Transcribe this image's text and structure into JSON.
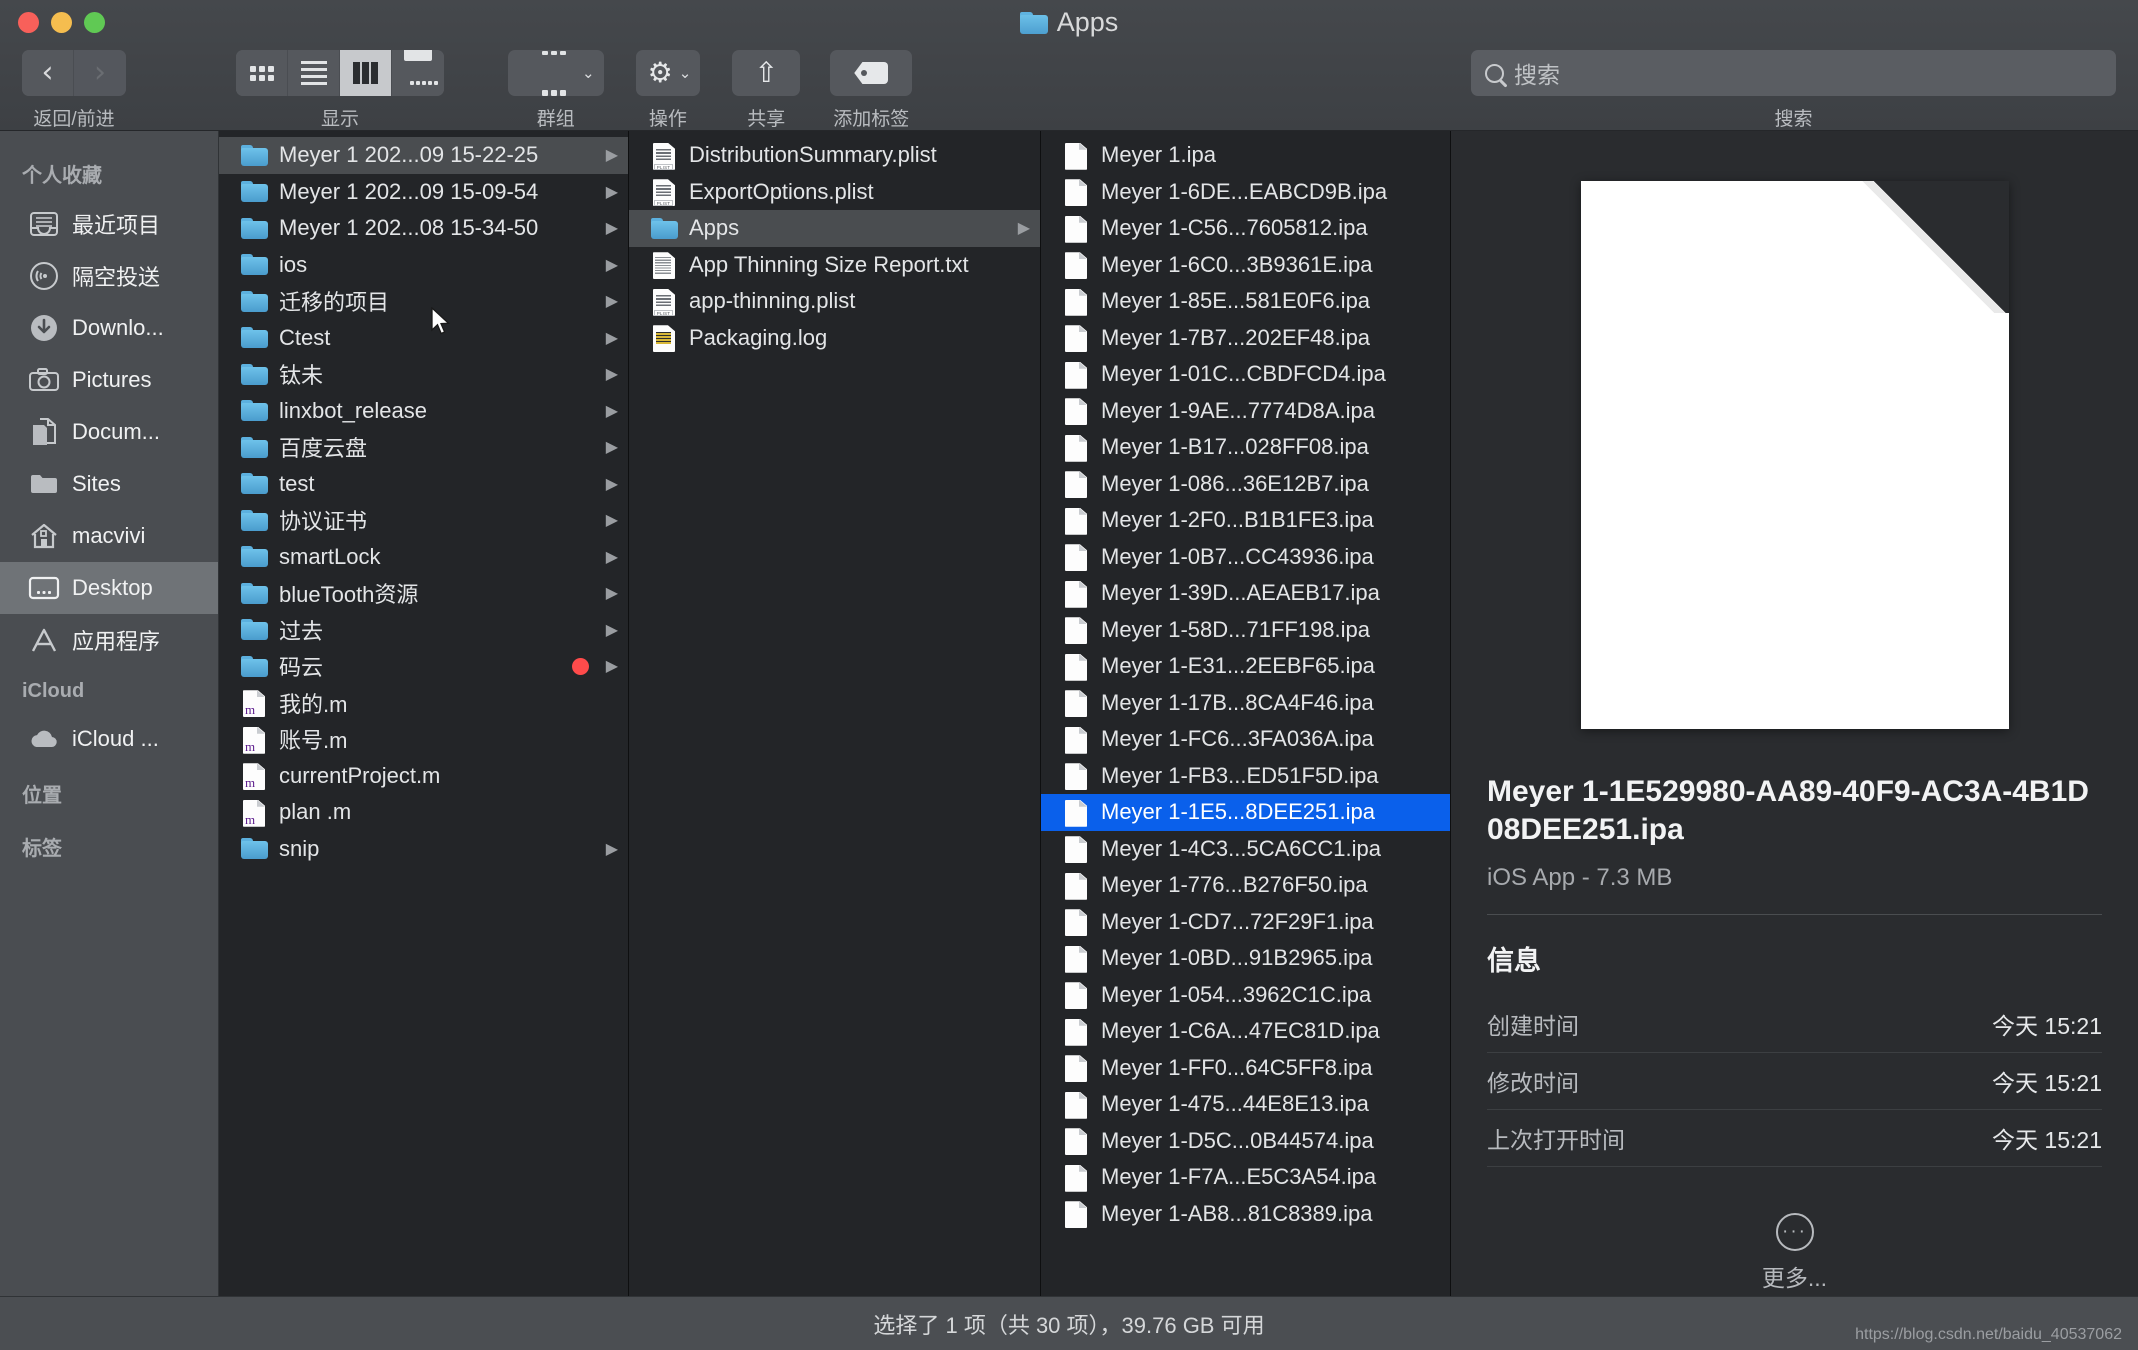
{
  "window": {
    "title": "Apps",
    "traffic_lights": [
      "close-red",
      "minimize-yellow",
      "zoom-green"
    ]
  },
  "toolbar": {
    "nav_label": "返回/前进",
    "back_glyph": "‹",
    "forward_glyph": "›",
    "view_label": "显示",
    "group_label": "群组",
    "action_label": "操作",
    "share_label": "共享",
    "tag_label": "添加标签",
    "search_label": "搜索",
    "gear_glyph": "⚙",
    "share_glyph": "⇧",
    "caret_glyph": "⌄"
  },
  "search": {
    "placeholder": "搜索",
    "value": ""
  },
  "sidebar": {
    "sections": [
      {
        "header": "个人收藏",
        "items": [
          {
            "label": "最近项目",
            "icon": "recents-icon",
            "selected": false
          },
          {
            "label": "隔空投送",
            "icon": "airdrop-icon",
            "selected": false
          },
          {
            "label": "Downlo...",
            "icon": "downloads-icon",
            "selected": false
          },
          {
            "label": "Pictures",
            "icon": "pictures-icon",
            "selected": false
          },
          {
            "label": "Docum...",
            "icon": "documents-icon",
            "selected": false
          },
          {
            "label": "Sites",
            "icon": "folder-icon",
            "selected": false
          },
          {
            "label": "macvivi",
            "icon": "home-icon",
            "selected": false
          },
          {
            "label": "Desktop",
            "icon": "desktop-icon",
            "selected": true
          },
          {
            "label": "应用程序",
            "icon": "applications-icon",
            "selected": false
          }
        ]
      },
      {
        "header": "iCloud",
        "items": [
          {
            "label": "iCloud ...",
            "icon": "cloud-icon",
            "selected": false
          }
        ]
      },
      {
        "header": "位置",
        "items": []
      },
      {
        "header": "标签",
        "items": []
      }
    ]
  },
  "columns": [
    {
      "name": "column-1",
      "rows": [
        {
          "label": "Meyer 1 202...09 15-22-25",
          "icon": "folder-icon",
          "arrow": true,
          "state": "highlight"
        },
        {
          "label": "Meyer 1 202...09 15-09-54",
          "icon": "folder-icon",
          "arrow": true,
          "state": "normal"
        },
        {
          "label": "Meyer 1 202...08 15-34-50",
          "icon": "folder-icon",
          "arrow": true,
          "state": "normal"
        },
        {
          "label": "ios",
          "icon": "folder-icon",
          "arrow": true,
          "state": "normal"
        },
        {
          "label": "迁移的项目",
          "icon": "folder-icon",
          "arrow": true,
          "state": "normal"
        },
        {
          "label": "Ctest",
          "icon": "folder-icon",
          "arrow": true,
          "state": "normal"
        },
        {
          "label": "钛未",
          "icon": "folder-icon",
          "arrow": true,
          "state": "normal"
        },
        {
          "label": "linxbot_release",
          "icon": "folder-icon",
          "arrow": true,
          "state": "normal"
        },
        {
          "label": "百度云盘",
          "icon": "folder-icon",
          "arrow": true,
          "state": "normal"
        },
        {
          "label": "test",
          "icon": "folder-icon",
          "arrow": true,
          "state": "normal"
        },
        {
          "label": "协议证书",
          "icon": "folder-icon",
          "arrow": true,
          "state": "normal"
        },
        {
          "label": "smartLock",
          "icon": "folder-icon",
          "arrow": true,
          "state": "normal"
        },
        {
          "label": "blueTooth资源",
          "icon": "folder-icon",
          "arrow": true,
          "state": "normal"
        },
        {
          "label": "过去",
          "icon": "folder-icon",
          "arrow": true,
          "state": "normal"
        },
        {
          "label": "码云",
          "icon": "folder-icon",
          "arrow": true,
          "state": "normal",
          "tag": "red"
        },
        {
          "label": "我的.m",
          "icon": "m-file-icon",
          "arrow": false,
          "state": "normal"
        },
        {
          "label": "账号.m",
          "icon": "m-file-icon",
          "arrow": false,
          "state": "normal"
        },
        {
          "label": "currentProject.m",
          "icon": "m-file-icon",
          "arrow": false,
          "state": "normal"
        },
        {
          "label": "plan .m",
          "icon": "m-file-icon",
          "arrow": false,
          "state": "normal"
        },
        {
          "label": "snip",
          "icon": "folder-icon",
          "arrow": true,
          "state": "normal"
        }
      ]
    },
    {
      "name": "column-2",
      "rows": [
        {
          "label": "DistributionSummary.plist",
          "icon": "plist-icon",
          "arrow": false,
          "state": "normal"
        },
        {
          "label": "ExportOptions.plist",
          "icon": "plist-icon",
          "arrow": false,
          "state": "normal"
        },
        {
          "label": "Apps",
          "icon": "folder-icon",
          "arrow": true,
          "state": "highlight"
        },
        {
          "label": "App Thinning Size Report.txt",
          "icon": "text-doc-icon",
          "arrow": false,
          "state": "normal"
        },
        {
          "label": "app-thinning.plist",
          "icon": "plist-icon",
          "arrow": false,
          "state": "normal"
        },
        {
          "label": "Packaging.log",
          "icon": "log-doc-icon",
          "arrow": false,
          "state": "normal"
        }
      ]
    },
    {
      "name": "column-3",
      "rows": [
        {
          "label": "Meyer 1.ipa",
          "icon": "doc-icon",
          "arrow": false,
          "state": "normal"
        },
        {
          "label": "Meyer 1-6DE...EABCD9B.ipa",
          "icon": "doc-icon",
          "arrow": false,
          "state": "normal"
        },
        {
          "label": "Meyer 1-C56...7605812.ipa",
          "icon": "doc-icon",
          "arrow": false,
          "state": "normal"
        },
        {
          "label": "Meyer 1-6C0...3B9361E.ipa",
          "icon": "doc-icon",
          "arrow": false,
          "state": "normal"
        },
        {
          "label": "Meyer 1-85E...581E0F6.ipa",
          "icon": "doc-icon",
          "arrow": false,
          "state": "normal"
        },
        {
          "label": "Meyer 1-7B7...202EF48.ipa",
          "icon": "doc-icon",
          "arrow": false,
          "state": "normal"
        },
        {
          "label": "Meyer 1-01C...CBDFCD4.ipa",
          "icon": "doc-icon",
          "arrow": false,
          "state": "normal"
        },
        {
          "label": "Meyer 1-9AE...7774D8A.ipa",
          "icon": "doc-icon",
          "arrow": false,
          "state": "normal"
        },
        {
          "label": "Meyer 1-B17...028FF08.ipa",
          "icon": "doc-icon",
          "arrow": false,
          "state": "normal"
        },
        {
          "label": "Meyer 1-086...36E12B7.ipa",
          "icon": "doc-icon",
          "arrow": false,
          "state": "normal"
        },
        {
          "label": "Meyer 1-2F0...B1B1FE3.ipa",
          "icon": "doc-icon",
          "arrow": false,
          "state": "normal"
        },
        {
          "label": "Meyer 1-0B7...CC43936.ipa",
          "icon": "doc-icon",
          "arrow": false,
          "state": "normal"
        },
        {
          "label": "Meyer 1-39D...AEAEB17.ipa",
          "icon": "doc-icon",
          "arrow": false,
          "state": "normal"
        },
        {
          "label": "Meyer 1-58D...71FF198.ipa",
          "icon": "doc-icon",
          "arrow": false,
          "state": "normal"
        },
        {
          "label": "Meyer 1-E31...2EEBF65.ipa",
          "icon": "doc-icon",
          "arrow": false,
          "state": "normal"
        },
        {
          "label": "Meyer 1-17B...8CA4F46.ipa",
          "icon": "doc-icon",
          "arrow": false,
          "state": "normal"
        },
        {
          "label": "Meyer 1-FC6...3FA036A.ipa",
          "icon": "doc-icon",
          "arrow": false,
          "state": "normal"
        },
        {
          "label": "Meyer 1-FB3...ED51F5D.ipa",
          "icon": "doc-icon",
          "arrow": false,
          "state": "normal"
        },
        {
          "label": "Meyer 1-1E5...8DEE251.ipa",
          "icon": "doc-icon",
          "arrow": false,
          "state": "selected"
        },
        {
          "label": "Meyer 1-4C3...5CA6CC1.ipa",
          "icon": "doc-icon",
          "arrow": false,
          "state": "normal"
        },
        {
          "label": "Meyer 1-776...B276F50.ipa",
          "icon": "doc-icon",
          "arrow": false,
          "state": "normal"
        },
        {
          "label": "Meyer 1-CD7...72F29F1.ipa",
          "icon": "doc-icon",
          "arrow": false,
          "state": "normal"
        },
        {
          "label": "Meyer 1-0BD...91B2965.ipa",
          "icon": "doc-icon",
          "arrow": false,
          "state": "normal"
        },
        {
          "label": "Meyer 1-054...3962C1C.ipa",
          "icon": "doc-icon",
          "arrow": false,
          "state": "normal"
        },
        {
          "label": "Meyer 1-C6A...47EC81D.ipa",
          "icon": "doc-icon",
          "arrow": false,
          "state": "normal"
        },
        {
          "label": "Meyer 1-FF0...64C5FF8.ipa",
          "icon": "doc-icon",
          "arrow": false,
          "state": "normal"
        },
        {
          "label": "Meyer 1-475...44E8E13.ipa",
          "icon": "doc-icon",
          "arrow": false,
          "state": "normal"
        },
        {
          "label": "Meyer 1-D5C...0B44574.ipa",
          "icon": "doc-icon",
          "arrow": false,
          "state": "normal"
        },
        {
          "label": "Meyer 1-F7A...E5C3A54.ipa",
          "icon": "doc-icon",
          "arrow": false,
          "state": "normal"
        },
        {
          "label": "Meyer 1-AB8...81C8389.ipa",
          "icon": "doc-icon",
          "arrow": false,
          "state": "normal"
        }
      ]
    }
  ],
  "preview": {
    "filename": "Meyer 1-1E529980-AA89-40F9-AC3A-4B1D08DEE251.ipa",
    "subtitle": "iOS App - 7.3 MB",
    "section_title": "信息",
    "info_rows": [
      {
        "label": "创建时间",
        "value": "今天 15:21"
      },
      {
        "label": "修改时间",
        "value": "今天 15:21"
      },
      {
        "label": "上次打开时间",
        "value": "今天 15:21"
      }
    ],
    "more_label": "更多...",
    "more_glyph": "···"
  },
  "statusbar": {
    "text": "选择了 1 项（共 30 项），39.76 GB 可用",
    "watermark": "https://blog.csdn.net/baidu_40537062"
  },
  "colors": {
    "selection_blue": "#0a60eb",
    "folder_blue": "#5cb0de",
    "tag_red": "#ff4b4b",
    "window_bg": "#3b3e42",
    "column_bg": "#232528",
    "sidebar_bg": "#4a4d51"
  }
}
